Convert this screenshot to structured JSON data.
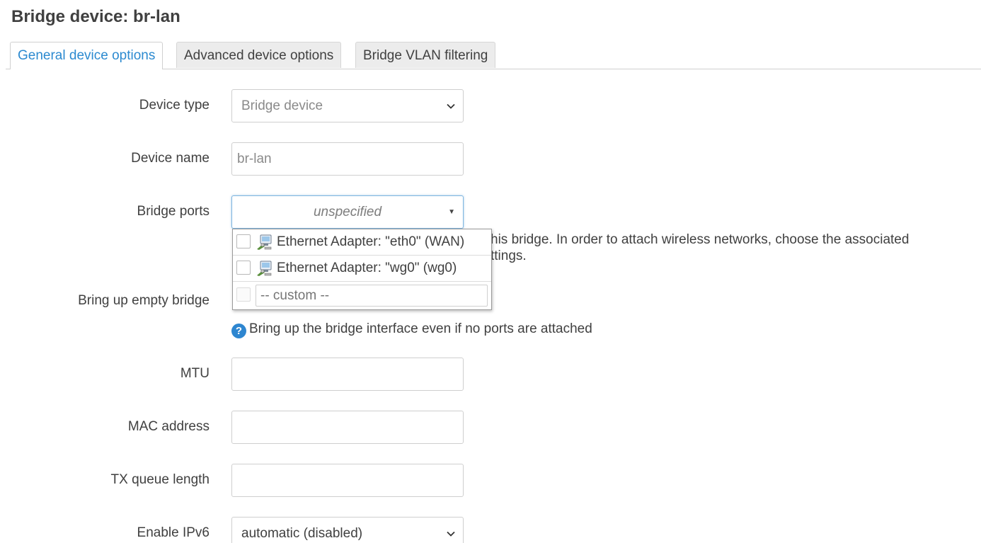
{
  "title": "Bridge device: br-lan",
  "tabs": [
    {
      "label": "General device options",
      "active": true
    },
    {
      "label": "Advanced device options",
      "active": false
    },
    {
      "label": "Bridge VLAN filtering",
      "active": false
    }
  ],
  "fields": {
    "device_type": {
      "label": "Device type",
      "value": "Bridge device",
      "icon": "chevron-down-icon"
    },
    "device_name": {
      "label": "Device name",
      "value": "br-lan"
    },
    "bridge_ports": {
      "label": "Bridge ports",
      "placeholder": "unspecified",
      "description_line1": "his bridge. In order to attach wireless networks, choose the associated",
      "description_line2": "ttings.",
      "options": [
        {
          "label": "Ethernet Adapter: \"eth0\" (WAN)",
          "checked": false,
          "icon": "ethernet-adapter-icon"
        },
        {
          "label": "Ethernet Adapter: \"wg0\" (wg0)",
          "checked": false,
          "icon": "ethernet-adapter-icon"
        }
      ],
      "custom_placeholder": "-- custom --"
    },
    "bring_up_empty": {
      "label": "Bring up empty bridge",
      "help": "Bring up the bridge interface even if no ports are attached",
      "help_icon": "?"
    },
    "mtu": {
      "label": "MTU",
      "value": ""
    },
    "mac_address": {
      "label": "MAC address",
      "value": ""
    },
    "tx_queue_length": {
      "label": "TX queue length",
      "value": ""
    },
    "enable_ipv6": {
      "label": "Enable IPv6",
      "value": "automatic (disabled)",
      "icon": "chevron-down-icon"
    }
  },
  "colors": {
    "accent": "#2c8ad0",
    "text": "#404040",
    "border": "#cfcfcf",
    "focus_border": "#7fb6e0"
  }
}
